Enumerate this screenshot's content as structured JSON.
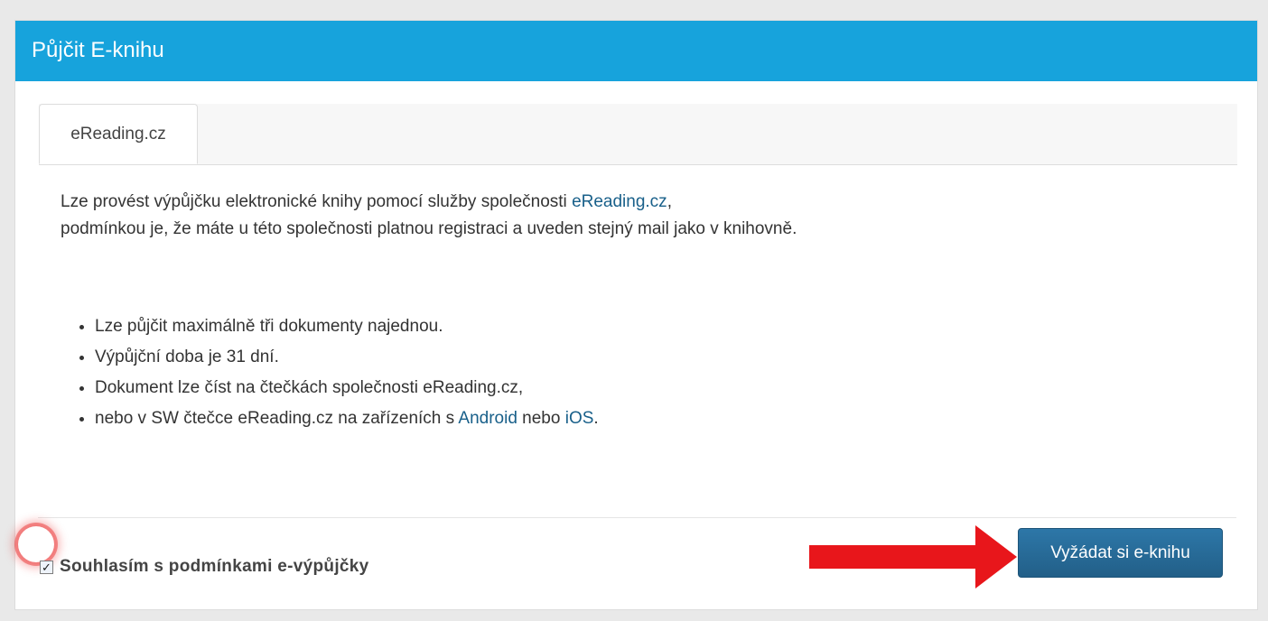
{
  "dialog": {
    "title": "Půjčit E-knihu",
    "header_color": "#17a3dc"
  },
  "tabs": [
    {
      "label": "eReading.cz",
      "active": true
    }
  ],
  "intro": {
    "line1_before": "Lze provést výpůjčku elektronické knihy pomocí služby společnosti ",
    "line1_link": "eReading.cz",
    "line1_after": ",",
    "line2": "podmínkou je, že máte u této společnosti platnou registraci a uveden stejný mail jako v knihovně."
  },
  "rules": {
    "item1": "Lze půjčit maximálně tři dokumenty najednou.",
    "item2": "Výpůjční doba je 31 dní.",
    "item3": "Dokument lze číst na čtečkách společnosti eReading.cz,",
    "item4_before": "nebo v SW čtečce eReading.cz na zařízeních s ",
    "item4_link1": "Android",
    "item4_mid": " nebo ",
    "item4_link2": "iOS",
    "item4_after": "."
  },
  "consent": {
    "checked": true,
    "checkmark": "✓",
    "label": "Souhlasím s podmínkami e-výpůjčky"
  },
  "submit_button": {
    "label": "Vyžádat si e-knihu",
    "color": "#2a6f9d"
  },
  "annotation": {
    "arrow_color": "#e8161b",
    "arrow_icon": "arrow-right-icon"
  }
}
